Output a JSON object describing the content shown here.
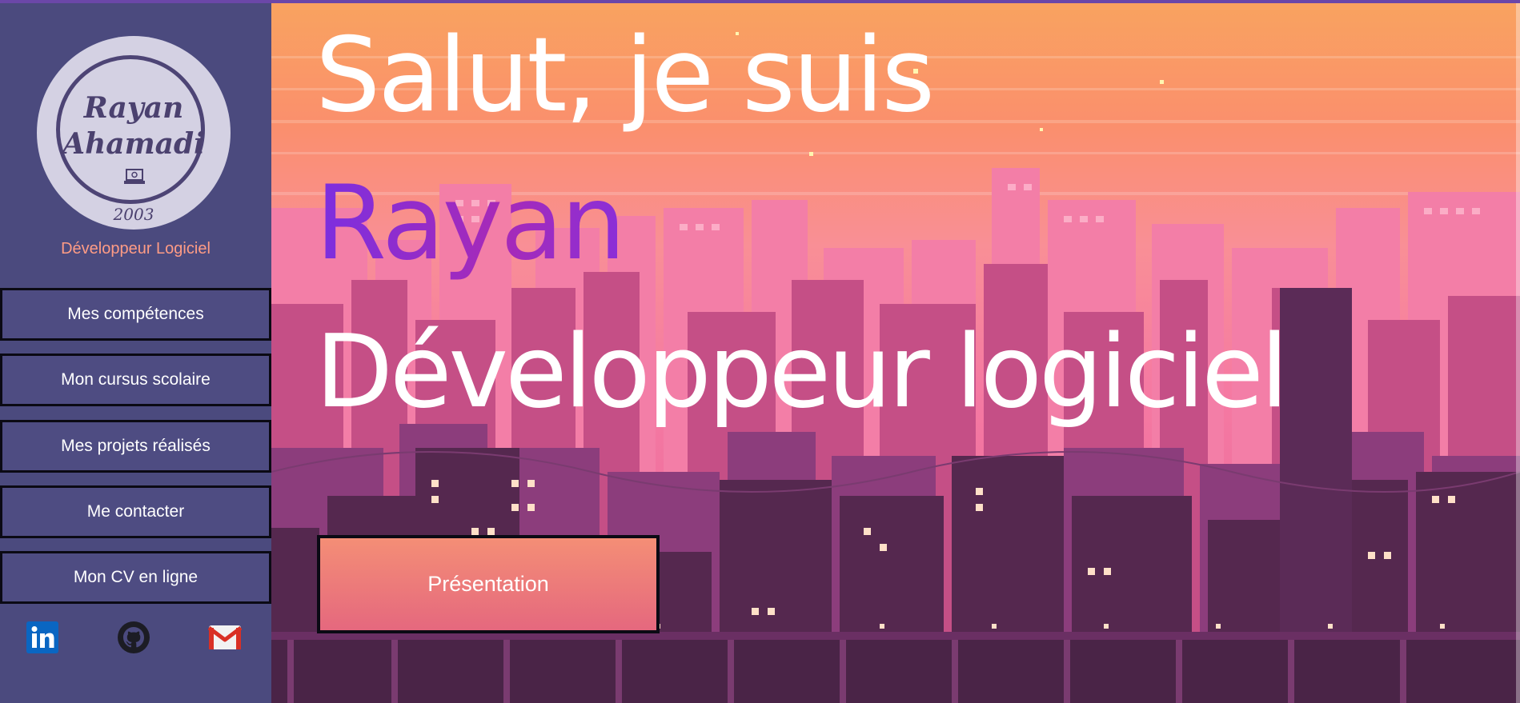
{
  "sidebar": {
    "logo": {
      "name_line1": "Rayan",
      "name_line2": "Ahamadi",
      "year": "2003"
    },
    "role": "Développeur Logiciel",
    "nav": [
      {
        "label": "Mes compétences"
      },
      {
        "label": "Mon cursus scolaire"
      },
      {
        "label": "Mes projets réalisés"
      },
      {
        "label": "Me contacter"
      },
      {
        "label": "Mon CV en ligne"
      }
    ],
    "socials": [
      {
        "icon": "linkedin-icon"
      },
      {
        "icon": "github-icon"
      },
      {
        "icon": "gmail-icon"
      }
    ]
  },
  "hero": {
    "line1": "Salut, je suis",
    "line2": "Rayan",
    "line3": "Développeur logiciel",
    "cta_label": "Présentation"
  },
  "colors": {
    "sidebar_bg": "#4b4a7e",
    "role_text": "#ff9c85",
    "name_gradient_start": "#7b2fe0",
    "name_gradient_end": "#a72ab7",
    "cta_top": "#f48e76",
    "cta_bottom": "#e5687e",
    "sky_top": "#f7a36b",
    "sky_bottom": "#f46e98"
  }
}
